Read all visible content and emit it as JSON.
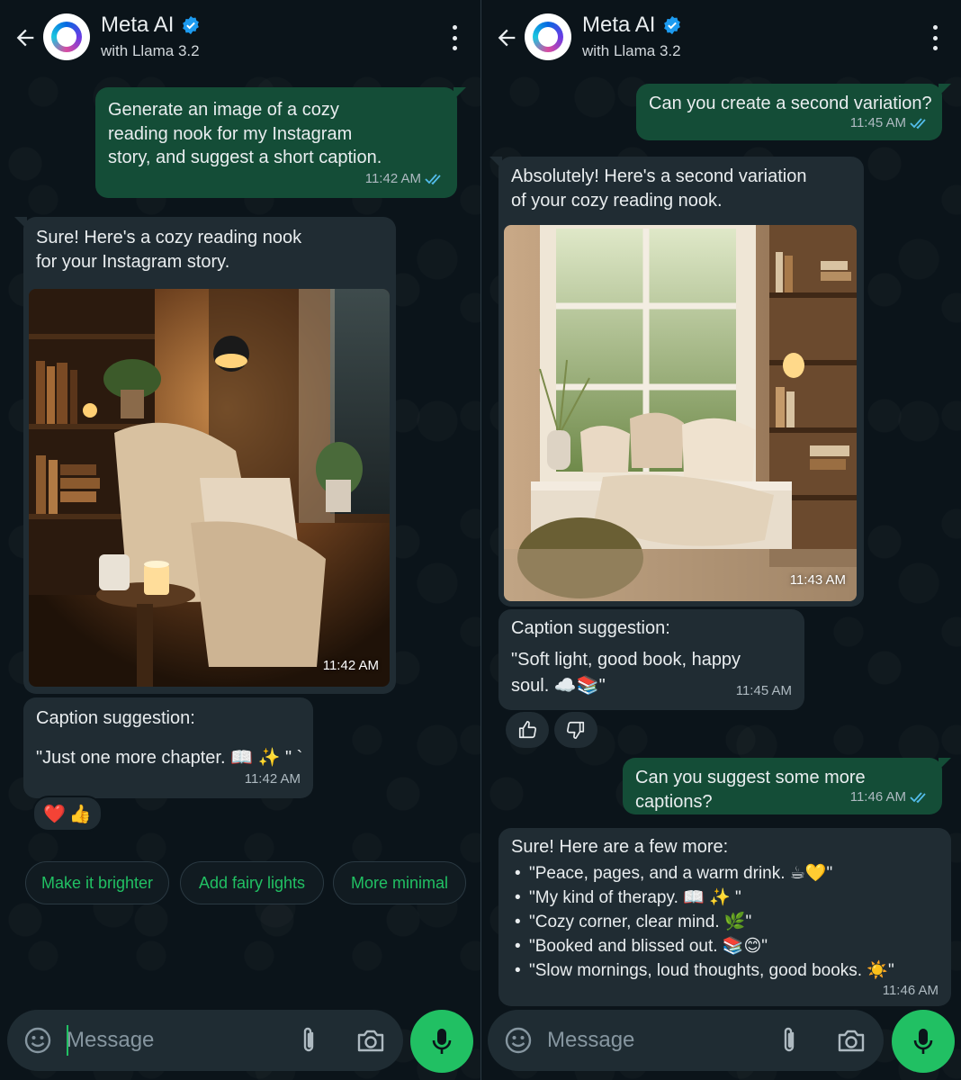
{
  "app": {
    "contact_name": "Meta AI",
    "contact_subtitle": "with Llama 3.2",
    "input_placeholder": "Message",
    "accent_color": "#21c063",
    "outgoing_bubble_color": "#144d37",
    "incoming_bubble_color": "#202c33"
  },
  "left": {
    "msg1": {
      "text_lines": [
        "Generate an image of a cozy",
        "reading nook for my Instagram",
        "story, and suggest a short caption."
      ],
      "time": "11:42 AM"
    },
    "msg2": {
      "text_lines": [
        "Sure! Here's a cozy reading nook",
        "for your Instagram story."
      ],
      "image_time": "11:42 AM"
    },
    "msg3": {
      "title": "Caption suggestion:",
      "caption": "\"Just one more chapter. 📖 ✨ \" `",
      "time": "11:42 AM"
    },
    "reactions": [
      "❤️",
      "👍"
    ],
    "chips": [
      "Make it brighter",
      "Add fairy lights",
      "More minimal"
    ]
  },
  "right": {
    "msg1": {
      "text": "Can you create a second variation?",
      "time": "11:45 AM"
    },
    "msg2": {
      "text_lines": [
        "Absolutely! Here's a second variation",
        "of your cozy reading nook."
      ],
      "image_time": "11:43 AM"
    },
    "msg3": {
      "title": "Caption suggestion:",
      "caption_line1": "\"Soft light, good book, happy",
      "caption_line2": "soul. ☁️📚\"",
      "time": "11:45 AM"
    },
    "msg4": {
      "text": "Can you suggest some more captions?",
      "time": "11:46 AM"
    },
    "msg5": {
      "intro": "Sure! Here are a few more:",
      "captions": [
        "\"Peace, pages, and a warm drink. ☕💛\"",
        "\"My kind of therapy. 📖 ✨ \"",
        "\"Cozy corner, clear mind. 🌿\"",
        "\"Booked and blissed out. 📚😊\"",
        "\"Slow mornings, loud thoughts, good books. ☀️\""
      ],
      "time": "11:46 AM"
    }
  },
  "icons": {
    "back": "arrow-left-icon",
    "verified": "verified-badge-icon",
    "menu": "kebab-menu-icon",
    "read": "double-check-icon",
    "emoji": "emoji-icon",
    "attach": "paperclip-icon",
    "camera": "camera-icon",
    "mic": "microphone-icon",
    "like": "thumbs-up-icon",
    "dislike": "thumbs-down-icon"
  }
}
